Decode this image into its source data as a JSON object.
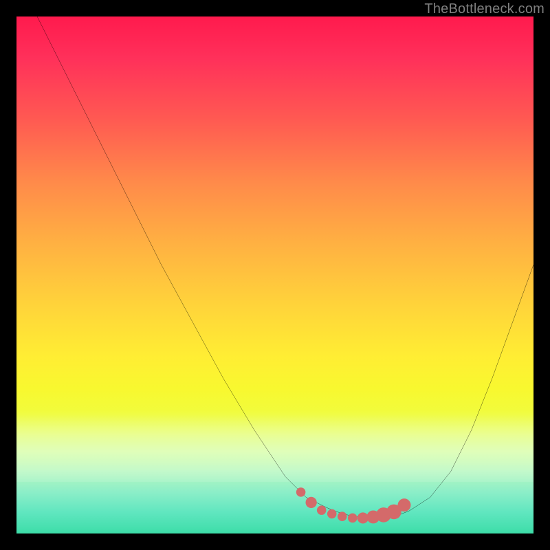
{
  "watermark": "TheBottleneck.com",
  "colors": {
    "frame": "#000000",
    "curve_stroke": "#000000",
    "marker_fill": "#d46a6a",
    "marker_stroke": "#d46a6a"
  },
  "chart_data": {
    "type": "line",
    "title": "",
    "xlabel": "",
    "ylabel": "",
    "xlim": [
      0,
      100
    ],
    "ylim": [
      0,
      100
    ],
    "x": [
      4,
      10,
      16,
      22,
      28,
      34,
      40,
      46,
      52,
      56,
      58,
      60,
      62,
      64,
      66,
      68,
      70,
      72,
      74,
      76,
      80,
      84,
      88,
      92,
      96,
      100
    ],
    "y": [
      100,
      88,
      76,
      64,
      52,
      41,
      30,
      20,
      11,
      7,
      6,
      5,
      4.2,
      3.6,
      3.2,
      3.0,
      3.0,
      3.2,
      3.6,
      4.4,
      7,
      12,
      20,
      30,
      41,
      52
    ],
    "markers": {
      "x": [
        55,
        57,
        59,
        61,
        63,
        65,
        67,
        69,
        71,
        73,
        75
      ],
      "y": [
        8,
        6,
        4.5,
        3.8,
        3.3,
        3.0,
        3.0,
        3.2,
        3.6,
        4.2,
        5.5
      ],
      "size": [
        5,
        6,
        5,
        5,
        5,
        5,
        6,
        7,
        8,
        8,
        7
      ]
    },
    "note": "Axes have no labels or ticks; values are normalized 0-100 estimates read from grid proportions."
  }
}
